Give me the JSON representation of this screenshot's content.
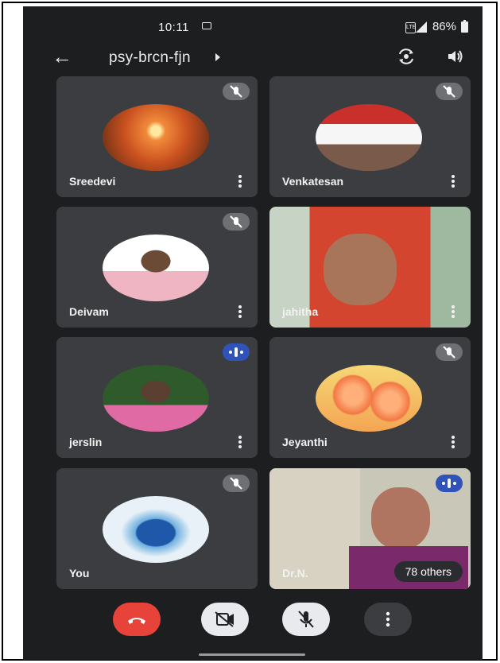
{
  "status": {
    "time": "10:11",
    "battery": "86%"
  },
  "meeting": {
    "code": "psy-brcn-fjn"
  },
  "participants": [
    {
      "name": "Sreedevi",
      "mic": "muted",
      "display": "avatar"
    },
    {
      "name": "Venkatesan",
      "mic": "muted",
      "display": "avatar"
    },
    {
      "name": "Deivam",
      "mic": "muted",
      "display": "avatar"
    },
    {
      "name": "jahitha",
      "mic": "unknown",
      "display": "video"
    },
    {
      "name": "jerslin",
      "mic": "speaking",
      "display": "avatar"
    },
    {
      "name": "Jeyanthi",
      "mic": "muted",
      "display": "avatar"
    },
    {
      "name": "You",
      "mic": "muted",
      "display": "avatar"
    },
    {
      "name": "Dr.N.",
      "mic": "speaking",
      "display": "video"
    }
  ],
  "others_label": "78 others",
  "controls": [
    "end-call",
    "camera-off",
    "mic-off",
    "more-options"
  ],
  "colors": {
    "background": "#1d1e20",
    "tile": "#3c3d40",
    "end_call": "#e8433a",
    "speaking": "#2f53b8",
    "muted_pill": "#6f7074"
  }
}
